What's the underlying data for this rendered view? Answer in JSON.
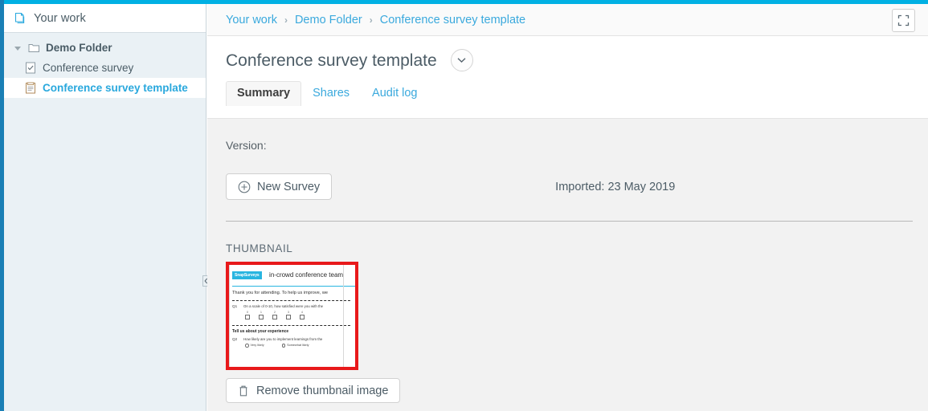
{
  "theme": {
    "accent": "#00b0e3",
    "link": "#3aa9dd",
    "text": "#4c5c66",
    "body_bg": "#f2f2f2",
    "sidebar_bg": "#eaf1f5",
    "highlight_border": "#e8191b"
  },
  "sidebar": {
    "header_label": "Your work",
    "header_icon": "copy-pages-icon",
    "tree": [
      {
        "label": "Demo Folder",
        "icon": "folder-icon",
        "level": 0,
        "expanded": true,
        "selected": false
      },
      {
        "label": "Conference survey",
        "icon": "survey-checked-document-icon",
        "level": 1,
        "expanded": false,
        "selected": false
      },
      {
        "label": "Conference survey template",
        "icon": "template-document-icon",
        "level": 1,
        "expanded": false,
        "selected": true
      }
    ],
    "collapse_handle_icon": "collapse-left-icon"
  },
  "breadcrumb": {
    "separator": "›",
    "items": [
      {
        "label": "Your work"
      },
      {
        "label": "Demo Folder"
      },
      {
        "label": "Conference survey template"
      }
    ],
    "fullscreen_icon": "fullscreen-expand-icon"
  },
  "page": {
    "title": "Conference survey template",
    "title_dropdown_icon": "chevron-down-icon"
  },
  "tabs": [
    {
      "label": "Summary",
      "active": true
    },
    {
      "label": "Shares",
      "active": false
    },
    {
      "label": "Audit log",
      "active": false
    }
  ],
  "summary": {
    "version_label": "Version:",
    "new_survey_label": "New Survey",
    "new_survey_icon": "plus-circle-icon",
    "imported_label": "Imported: 23 May 2019",
    "thumbnail_heading": "THUMBNAIL",
    "remove_thumbnail_label": "Remove thumbnail image",
    "remove_thumbnail_icon": "trash-icon"
  },
  "thumbnail_preview": {
    "logo_text": "SnapSurveys",
    "title": "in-crowd conference team",
    "intro": "Thank you for attending. To help us improve, we",
    "q1_number": "Q1",
    "q1_text": "On a scale of 0-10, how satisfied were you with the",
    "q1_scale": [
      "0",
      "1",
      "2",
      "3",
      "4"
    ],
    "section_heading": "Tell us about your experience",
    "q2_number": "Q2",
    "q2_text": "How likely are you to implement learnings from the",
    "q2_options": [
      "Very likely",
      "Somewhat likely"
    ]
  }
}
